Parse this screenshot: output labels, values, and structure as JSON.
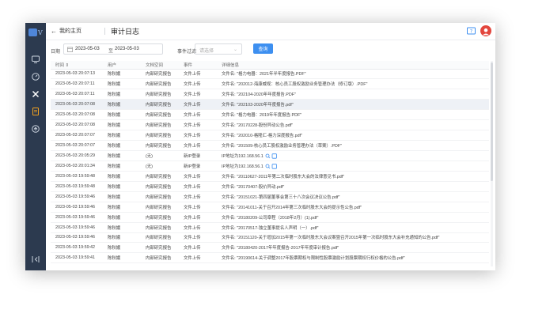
{
  "sidebar": {
    "logo_letter": "V",
    "icons": [
      "monitor-icon",
      "dashboard-icon",
      "tools-icon",
      "document-icon",
      "upload-icon"
    ],
    "active_index": 3,
    "collapse_icon": "collapse-icon"
  },
  "topbar": {
    "back_label": "我的主页",
    "title": "审计日志"
  },
  "filters": {
    "date_label": "日期",
    "date_from": "2023-05-03",
    "date_to_word": "至",
    "date_to": "2023-05-03",
    "event_label": "事件过滤",
    "event_placeholder": "请选择",
    "query_button": "查询"
  },
  "table": {
    "columns": [
      "时间 ⇕",
      "用户",
      "文档空间",
      "事件",
      "详细信息"
    ],
    "rows": [
      {
        "time": "2023-05-03 20:07:13",
        "user": "陈秋娥",
        "space": "内部研究报告",
        "event": "文件上传",
        "detail": "文件名: \"格力电器：2021年半年度报告.PDF\""
      },
      {
        "time": "2023-05-03 20:07:11",
        "user": "陈秋娥",
        "space": "内部研究报告",
        "event": "文件上传",
        "detail": "文件名: \"202012-海康威视：核心员工股权激励业务管理办法（修订版）.PDF\""
      },
      {
        "time": "2023-05-03 20:07:11",
        "user": "陈秋娥",
        "space": "内部研究报告",
        "event": "文件上传",
        "detail": "文件名: \"202104-2020年年度报告.PDF\""
      },
      {
        "time": "2023-05-03 20:07:08",
        "user": "陈秋娥",
        "space": "内部研究报告",
        "event": "文件上传",
        "detail": "文件名: \"202103-2020年年度报告.pdf\""
      },
      {
        "time": "2023-05-03 20:07:08",
        "user": "陈秋娥",
        "space": "内部研究报告",
        "event": "文件上传",
        "detail": "文件名: \"格力电器：2019年年度报告.PDF\""
      },
      {
        "time": "2023-05-03 20:07:08",
        "user": "陈秋娥",
        "space": "内部研究报告",
        "event": "文件上传",
        "detail": "文件名: \"20170228-股份异动公告.pdf\""
      },
      {
        "time": "2023-05-03 20:07:07",
        "user": "陈秋娥",
        "space": "内部研究报告",
        "event": "文件上传",
        "detail": "文件名: \"202010-格隆汇-格力深度报告.pdf\""
      },
      {
        "time": "2023-05-03 20:07:07",
        "user": "陈秋娥",
        "space": "内部研究报告",
        "event": "文件上传",
        "detail": "文件名: \"201509-核心员工股权激励业务管理办法（草案）.PDF\""
      },
      {
        "time": "2023-05-03 20:05:29",
        "user": "陈秋娥",
        "space": "(无)",
        "event": "新IP登录",
        "detail": "IP地址为192.168.56.1",
        "ip": true
      },
      {
        "time": "2023-05-03 20:01:34",
        "user": "陈秋娥",
        "space": "(无)",
        "event": "新IP登录",
        "detail": "IP地址为192.168.56.1",
        "ip": true
      },
      {
        "time": "2023-05-03 19:59:48",
        "user": "陈秋娥",
        "space": "内部研究报告",
        "event": "文件上传",
        "detail": "文件名: \"20110627-2011年第二次临时股东大会的法律意见书.pdf\""
      },
      {
        "time": "2023-05-03 19:59:48",
        "user": "陈秋娥",
        "space": "内部研究报告",
        "event": "文件上传",
        "detail": "文件名: \"20170407-股价异动.pdf\""
      },
      {
        "time": "2023-05-03 19:59:46",
        "user": "陈秋娥",
        "space": "内部研究报告",
        "event": "文件上传",
        "detail": "文件名: \"20151021-第四届董事会第三十八次会议决议公告.pdf\""
      },
      {
        "time": "2023-05-03 19:59:46",
        "user": "陈秋娥",
        "space": "内部研究报告",
        "event": "文件上传",
        "detail": "文件名: \"20141011-关于召开2014年第三次临时股东大会的提示性公告.pdf\""
      },
      {
        "time": "2023-05-03 19:59:46",
        "user": "陈秋娥",
        "space": "内部研究报告",
        "event": "文件上传",
        "detail": "文件名: \"20180209-公司章程（2018年2月）(1).pdf\""
      },
      {
        "time": "2023-05-03 19:59:46",
        "user": "陈秋娥",
        "space": "内部研究报告",
        "event": "文件上传",
        "detail": "文件名: \"20170517-独立董事提名人声明（一）.pdf\""
      },
      {
        "time": "2023-05-03 19:59:46",
        "user": "陈秋娥",
        "space": "内部研究报告",
        "event": "文件上传",
        "detail": "文件名: \"20151120-关于增加2015年第一次临时股东大会议案暨召开2015年第一次临时股东大会补充通知的公告.pdf\""
      },
      {
        "time": "2023-05-03 19:59:42",
        "user": "陈秋娥",
        "space": "内部研究报告",
        "event": "文件上传",
        "detail": "文件名: \"20180420-2017年年度报告-2017年年度审计报告.pdf\""
      },
      {
        "time": "2023-05-03 19:59:41",
        "user": "陈秋娥",
        "space": "内部研究报告",
        "event": "文件上传",
        "detail": "文件名: \"20190614-关于调整2017年股票期权与限制性股票激励计划股票期权行权价格的公告.pdf\""
      }
    ],
    "highlight_index": 3
  },
  "colors": {
    "sidebar_bg": "#2c3a4f",
    "accent": "#3d8ff0",
    "active_icon": "#f0a020",
    "avatar": "#e3463d"
  }
}
